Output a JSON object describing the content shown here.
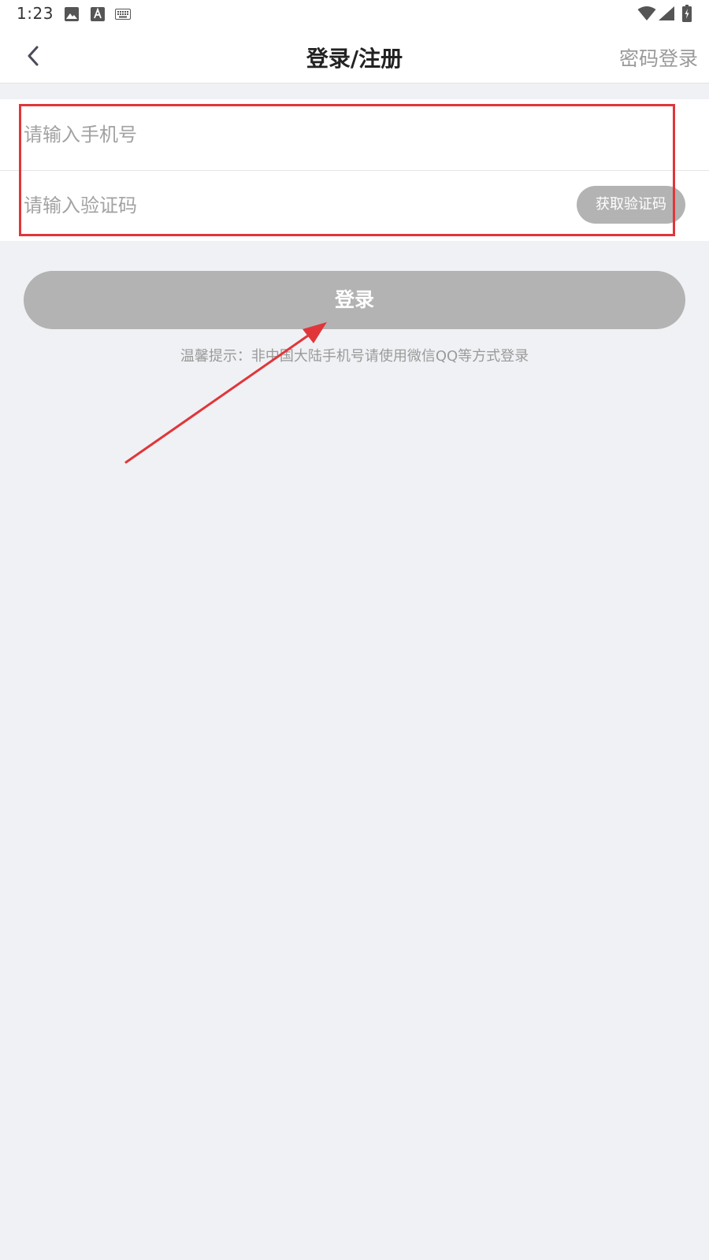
{
  "status_bar": {
    "time": "1:23",
    "icons": [
      "image-icon",
      "font-icon",
      "keyboard-icon",
      "wifi-icon",
      "signal-icon",
      "battery-charging-icon"
    ]
  },
  "navbar": {
    "back_icon": "chevron-left-icon",
    "title": "登录/注册",
    "right_action": "密码登录"
  },
  "form": {
    "phone_placeholder": "请输入手机号",
    "code_placeholder": "请输入验证码",
    "get_code_label": "获取验证码"
  },
  "login_button": "登录",
  "tip": "温馨提示：非中国大陆手机号请使用微信QQ等方式登录",
  "colors": {
    "background": "#f0f1f4",
    "button_disabled": "#b3b3b3",
    "annotation": "#e0363a",
    "placeholder": "#a2a2a2"
  }
}
